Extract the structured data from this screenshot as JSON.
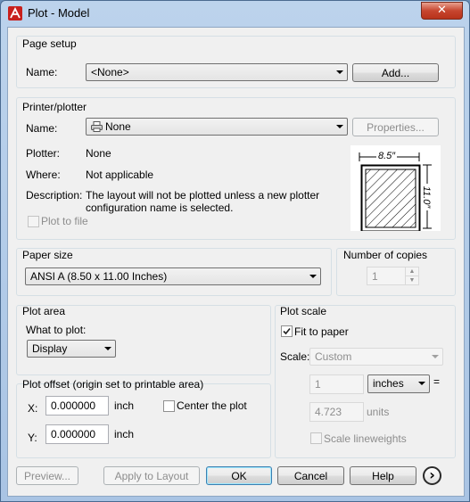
{
  "window": {
    "title": "Plot - Model",
    "close": "✕"
  },
  "page_setup": {
    "legend": "Page setup",
    "name_label": "Name:",
    "name_value": "<None>",
    "add_button": "Add..."
  },
  "printer": {
    "legend": "Printer/plotter",
    "name_label": "Name:",
    "name_value": "None",
    "properties_button": "Properties...",
    "plotter_label": "Plotter:",
    "plotter_value": "None",
    "where_label": "Where:",
    "where_value": "Not applicable",
    "description_label": "Description:",
    "description_line1": "The layout will not be plotted unless a new plotter",
    "description_line2": "configuration name is selected.",
    "plot_to_file": "Plot to file",
    "preview_width": "8.5″",
    "preview_height": "11.0″"
  },
  "paper_size": {
    "legend": "Paper size",
    "value": "ANSI A (8.50 x 11.00 Inches)"
  },
  "copies": {
    "legend": "Number of copies",
    "value": "1"
  },
  "plot_area": {
    "legend": "Plot area",
    "what_label": "What to plot:",
    "what_value": "Display"
  },
  "plot_offset": {
    "legend": "Plot offset (origin set to printable area)",
    "x_label": "X:",
    "x_value": "0.000000",
    "x_unit": "inch",
    "y_label": "Y:",
    "y_value": "0.000000",
    "y_unit": "inch",
    "center_label": "Center the plot"
  },
  "plot_scale": {
    "legend": "Plot scale",
    "fit_label": "Fit to paper",
    "fit_checked": true,
    "scale_label": "Scale:",
    "scale_value": "Custom",
    "value1": "1",
    "unit1": "inches",
    "equals": "=",
    "value2": "4.723",
    "unit2": "units",
    "lineweights_label": "Scale lineweights"
  },
  "buttons": {
    "preview": "Preview...",
    "apply": "Apply to Layout",
    "ok": "OK",
    "cancel": "Cancel",
    "help": "Help",
    "more": "›"
  }
}
